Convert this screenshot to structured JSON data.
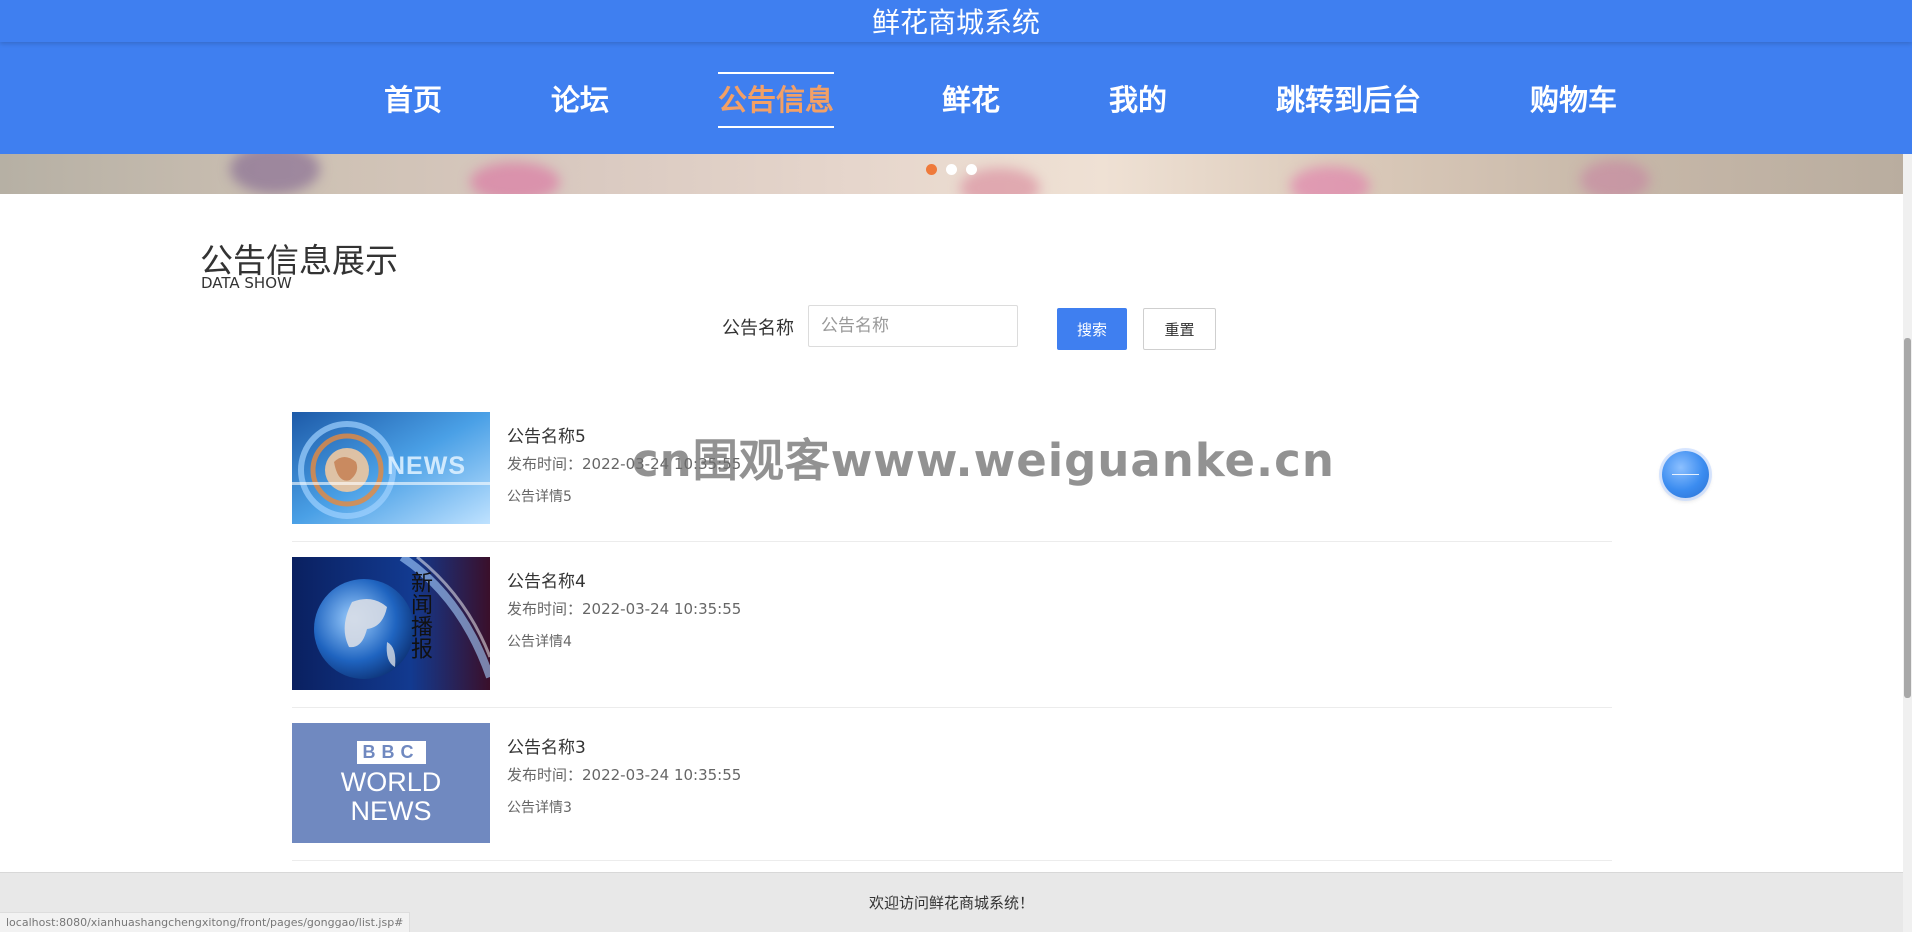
{
  "app": {
    "title": "鲜花商城系统"
  },
  "nav": {
    "items": [
      {
        "label": "首页",
        "active": false
      },
      {
        "label": "论坛",
        "active": false
      },
      {
        "label": "公告信息",
        "active": true
      },
      {
        "label": "鲜花",
        "active": false
      },
      {
        "label": "我的",
        "active": false
      },
      {
        "label": "跳转到后台",
        "active": false
      },
      {
        "label": "购物车",
        "active": false
      }
    ]
  },
  "banner": {
    "slide_count": 3,
    "active_index": 0
  },
  "section": {
    "title": "公告信息展示",
    "subtitle": "DATA SHOW"
  },
  "search": {
    "label": "公告名称",
    "placeholder": "公告名称",
    "value": "",
    "search_label": "搜索",
    "reset_label": "重置"
  },
  "list": [
    {
      "title": "公告名称5",
      "time": "发布时间：2022-03-24 10:35:55",
      "detail": "公告详情5",
      "thumb_text": "NEWS"
    },
    {
      "title": "公告名称4",
      "time": "发布时间：2022-03-24 10:35:55",
      "detail": "公告详情4",
      "thumb_text": "新闻播报"
    },
    {
      "title": "公告名称3",
      "time": "发布时间：2022-03-24 10:35:55",
      "detail": "公告详情3",
      "thumb_text_1": "BBC",
      "thumb_text_2": "WORLD",
      "thumb_text_3": "NEWS"
    }
  ],
  "watermark": "cn围观客www.weiguanke.cn",
  "footer": {
    "text": "欢迎访问鲜花商城系统！"
  },
  "status_bar": {
    "url": "localhost:8080/xianhuashangchengxitong/front/pages/gonggao/list.jsp#"
  },
  "colors": {
    "primary": "#3f7ff0",
    "active_nav": "#f3a066",
    "active_dot": "#ef7a3b"
  }
}
